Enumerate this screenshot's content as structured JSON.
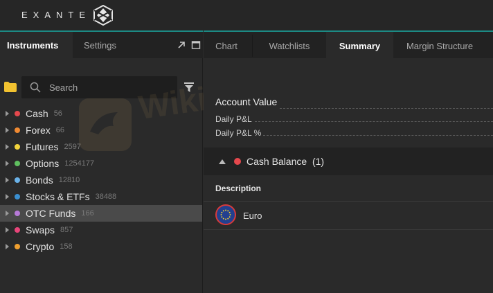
{
  "brand": {
    "name": "EXANTE"
  },
  "left_panel": {
    "tabs": [
      {
        "label": "Instruments",
        "active": true
      },
      {
        "label": "Settings",
        "active": false
      }
    ],
    "search": {
      "placeholder": "Search"
    },
    "tree": [
      {
        "label": "Cash",
        "count": "56",
        "color": "#e5484d"
      },
      {
        "label": "Forex",
        "count": "66",
        "color": "#f08a32"
      },
      {
        "label": "Futures",
        "count": "2597",
        "color": "#f2d43c"
      },
      {
        "label": "Options",
        "count": "1254177",
        "color": "#5fbf5f"
      },
      {
        "label": "Bonds",
        "count": "12810",
        "color": "#6ab2e8"
      },
      {
        "label": "Stocks & ETFs",
        "count": "38488",
        "color": "#3a8fd0"
      },
      {
        "label": "OTC Funds",
        "count": "166",
        "color": "#b77ad8",
        "selected": true
      },
      {
        "label": "Swaps",
        "count": "857",
        "color": "#e8457a"
      },
      {
        "label": "Crypto",
        "count": "158",
        "color": "#f0a030"
      }
    ]
  },
  "right_panel": {
    "tabs": [
      {
        "label": "Chart",
        "active": false
      },
      {
        "label": "Watchlists",
        "active": false
      },
      {
        "label": "Summary",
        "active": true
      },
      {
        "label": "Margin Structure",
        "active": false
      }
    ],
    "account": {
      "title": "Account Value",
      "daily_pnl": "Daily P&L",
      "daily_pnl_pct": "Daily P&L %"
    },
    "cash_balance": {
      "title": "Cash Balance",
      "count": "(1)"
    },
    "table": {
      "header": "Description",
      "rows": [
        {
          "description": "Euro"
        }
      ]
    }
  },
  "watermark": {
    "text": "WikiFX"
  }
}
